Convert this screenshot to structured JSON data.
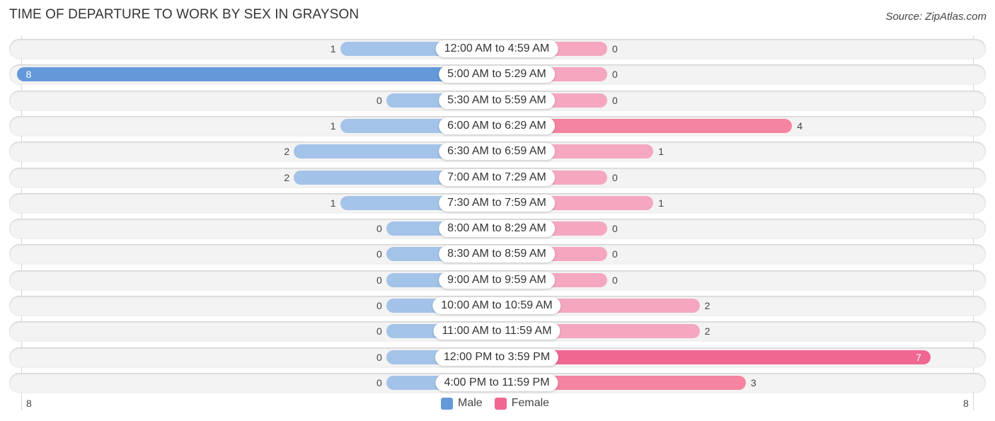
{
  "title": "TIME OF DEPARTURE TO WORK BY SEX IN GRAYSON",
  "source": "Source: ZipAtlas.com",
  "colors": {
    "male": "#6399d8",
    "male_light": "#a4c3e8",
    "female": "#f06792",
    "female_light": "#f5a7c0"
  },
  "chart_data": {
    "type": "bar",
    "orientation": "horizontal-diverging",
    "title": "TIME OF DEPARTURE TO WORK BY SEX IN GRAYSON",
    "categories": [
      "12:00 AM to 4:59 AM",
      "5:00 AM to 5:29 AM",
      "5:30 AM to 5:59 AM",
      "6:00 AM to 6:29 AM",
      "6:30 AM to 6:59 AM",
      "7:00 AM to 7:29 AM",
      "7:30 AM to 7:59 AM",
      "8:00 AM to 8:29 AM",
      "8:30 AM to 8:59 AM",
      "9:00 AM to 9:59 AM",
      "10:00 AM to 10:59 AM",
      "11:00 AM to 11:59 AM",
      "12:00 PM to 3:59 PM",
      "4:00 PM to 11:59 PM"
    ],
    "series": [
      {
        "name": "Male",
        "values": [
          1,
          8,
          0,
          1,
          2,
          2,
          1,
          0,
          0,
          0,
          0,
          0,
          0,
          0
        ]
      },
      {
        "name": "Female",
        "values": [
          0,
          0,
          0,
          4,
          1,
          0,
          1,
          0,
          0,
          0,
          2,
          2,
          7,
          3
        ]
      }
    ],
    "axis": {
      "left_max_label": "8",
      "right_max_label": "8",
      "range": [
        -8,
        8
      ]
    },
    "legend": {
      "position": "bottom-center",
      "entries": [
        "Male",
        "Female"
      ]
    },
    "grid": false
  }
}
